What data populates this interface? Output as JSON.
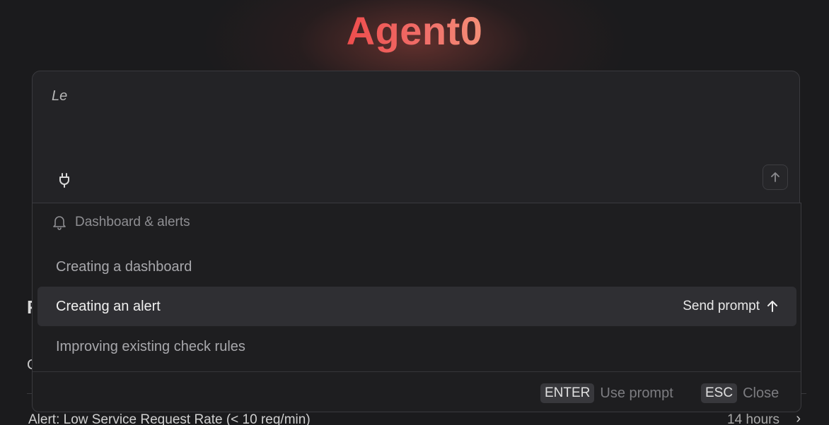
{
  "brand": {
    "title": "Agent0"
  },
  "background_page": {
    "heading_fragment": "F",
    "subheading_fragment": "C",
    "row": {
      "title": "Alert: Low Service Request Rate (< 10 req/min)",
      "time": "14 hours"
    }
  },
  "prompt": {
    "text": "Le",
    "plug_icon": "plug-icon",
    "send_icon": "arrow-up-icon"
  },
  "suggestions": {
    "group": {
      "icon": "bell-icon",
      "label": "Dashboard & alerts"
    },
    "items": [
      {
        "label": "Creating a dashboard",
        "active": false
      },
      {
        "label": "Creating an alert",
        "active": true
      },
      {
        "label": "Improving existing check rules",
        "active": false
      }
    ],
    "send_prompt_label": "Send prompt"
  },
  "footer": {
    "enter_key": "ENTER",
    "enter_label": "Use prompt",
    "esc_key": "ESC",
    "esc_label": "Close"
  },
  "colors": {
    "brand_start": "#ee4d4d",
    "brand_end": "#f58f78",
    "active_item_bg": "#2f2f33"
  }
}
